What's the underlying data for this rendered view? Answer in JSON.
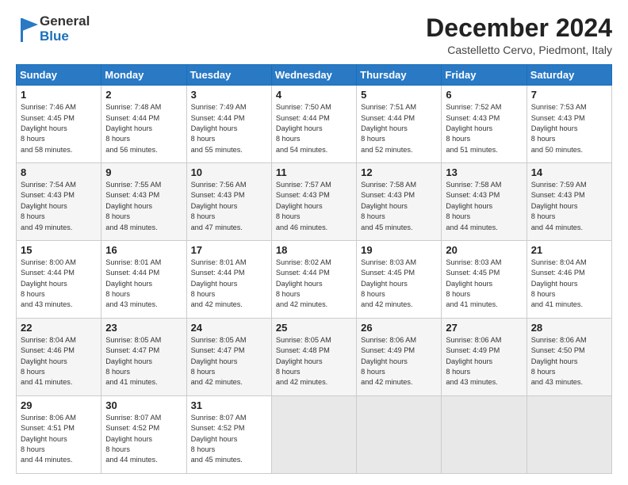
{
  "logo": {
    "line1": "General",
    "line2": "Blue"
  },
  "title": "December 2024",
  "location": "Castelletto Cervo, Piedmont, Italy",
  "days_header": [
    "Sunday",
    "Monday",
    "Tuesday",
    "Wednesday",
    "Thursday",
    "Friday",
    "Saturday"
  ],
  "weeks": [
    [
      {
        "day": "1",
        "rise": "7:46 AM",
        "set": "4:45 PM",
        "hours": "8 hours",
        "mins": "and 58 minutes."
      },
      {
        "day": "2",
        "rise": "7:48 AM",
        "set": "4:44 PM",
        "hours": "8 hours",
        "mins": "and 56 minutes."
      },
      {
        "day": "3",
        "rise": "7:49 AM",
        "set": "4:44 PM",
        "hours": "8 hours",
        "mins": "and 55 minutes."
      },
      {
        "day": "4",
        "rise": "7:50 AM",
        "set": "4:44 PM",
        "hours": "8 hours",
        "mins": "and 54 minutes."
      },
      {
        "day": "5",
        "rise": "7:51 AM",
        "set": "4:44 PM",
        "hours": "8 hours",
        "mins": "and 52 minutes."
      },
      {
        "day": "6",
        "rise": "7:52 AM",
        "set": "4:43 PM",
        "hours": "8 hours",
        "mins": "and 51 minutes."
      },
      {
        "day": "7",
        "rise": "7:53 AM",
        "set": "4:43 PM",
        "hours": "8 hours",
        "mins": "and 50 minutes."
      }
    ],
    [
      {
        "day": "8",
        "rise": "7:54 AM",
        "set": "4:43 PM",
        "hours": "8 hours",
        "mins": "and 49 minutes."
      },
      {
        "day": "9",
        "rise": "7:55 AM",
        "set": "4:43 PM",
        "hours": "8 hours",
        "mins": "and 48 minutes."
      },
      {
        "day": "10",
        "rise": "7:56 AM",
        "set": "4:43 PM",
        "hours": "8 hours",
        "mins": "and 47 minutes."
      },
      {
        "day": "11",
        "rise": "7:57 AM",
        "set": "4:43 PM",
        "hours": "8 hours",
        "mins": "and 46 minutes."
      },
      {
        "day": "12",
        "rise": "7:58 AM",
        "set": "4:43 PM",
        "hours": "8 hours",
        "mins": "and 45 minutes."
      },
      {
        "day": "13",
        "rise": "7:58 AM",
        "set": "4:43 PM",
        "hours": "8 hours",
        "mins": "and 44 minutes."
      },
      {
        "day": "14",
        "rise": "7:59 AM",
        "set": "4:43 PM",
        "hours": "8 hours",
        "mins": "and 44 minutes."
      }
    ],
    [
      {
        "day": "15",
        "rise": "8:00 AM",
        "set": "4:44 PM",
        "hours": "8 hours",
        "mins": "and 43 minutes."
      },
      {
        "day": "16",
        "rise": "8:01 AM",
        "set": "4:44 PM",
        "hours": "8 hours",
        "mins": "and 43 minutes."
      },
      {
        "day": "17",
        "rise": "8:01 AM",
        "set": "4:44 PM",
        "hours": "8 hours",
        "mins": "and 42 minutes."
      },
      {
        "day": "18",
        "rise": "8:02 AM",
        "set": "4:44 PM",
        "hours": "8 hours",
        "mins": "and 42 minutes."
      },
      {
        "day": "19",
        "rise": "8:03 AM",
        "set": "4:45 PM",
        "hours": "8 hours",
        "mins": "and 42 minutes."
      },
      {
        "day": "20",
        "rise": "8:03 AM",
        "set": "4:45 PM",
        "hours": "8 hours",
        "mins": "and 41 minutes."
      },
      {
        "day": "21",
        "rise": "8:04 AM",
        "set": "4:46 PM",
        "hours": "8 hours",
        "mins": "and 41 minutes."
      }
    ],
    [
      {
        "day": "22",
        "rise": "8:04 AM",
        "set": "4:46 PM",
        "hours": "8 hours",
        "mins": "and 41 minutes."
      },
      {
        "day": "23",
        "rise": "8:05 AM",
        "set": "4:47 PM",
        "hours": "8 hours",
        "mins": "and 41 minutes."
      },
      {
        "day": "24",
        "rise": "8:05 AM",
        "set": "4:47 PM",
        "hours": "8 hours",
        "mins": "and 42 minutes."
      },
      {
        "day": "25",
        "rise": "8:05 AM",
        "set": "4:48 PM",
        "hours": "8 hours",
        "mins": "and 42 minutes."
      },
      {
        "day": "26",
        "rise": "8:06 AM",
        "set": "4:49 PM",
        "hours": "8 hours",
        "mins": "and 42 minutes."
      },
      {
        "day": "27",
        "rise": "8:06 AM",
        "set": "4:49 PM",
        "hours": "8 hours",
        "mins": "and 43 minutes."
      },
      {
        "day": "28",
        "rise": "8:06 AM",
        "set": "4:50 PM",
        "hours": "8 hours",
        "mins": "and 43 minutes."
      }
    ],
    [
      {
        "day": "29",
        "rise": "8:06 AM",
        "set": "4:51 PM",
        "hours": "8 hours",
        "mins": "and 44 minutes."
      },
      {
        "day": "30",
        "rise": "8:07 AM",
        "set": "4:52 PM",
        "hours": "8 hours",
        "mins": "and 44 minutes."
      },
      {
        "day": "31",
        "rise": "8:07 AM",
        "set": "4:52 PM",
        "hours": "8 hours",
        "mins": "and 45 minutes."
      },
      null,
      null,
      null,
      null
    ]
  ]
}
